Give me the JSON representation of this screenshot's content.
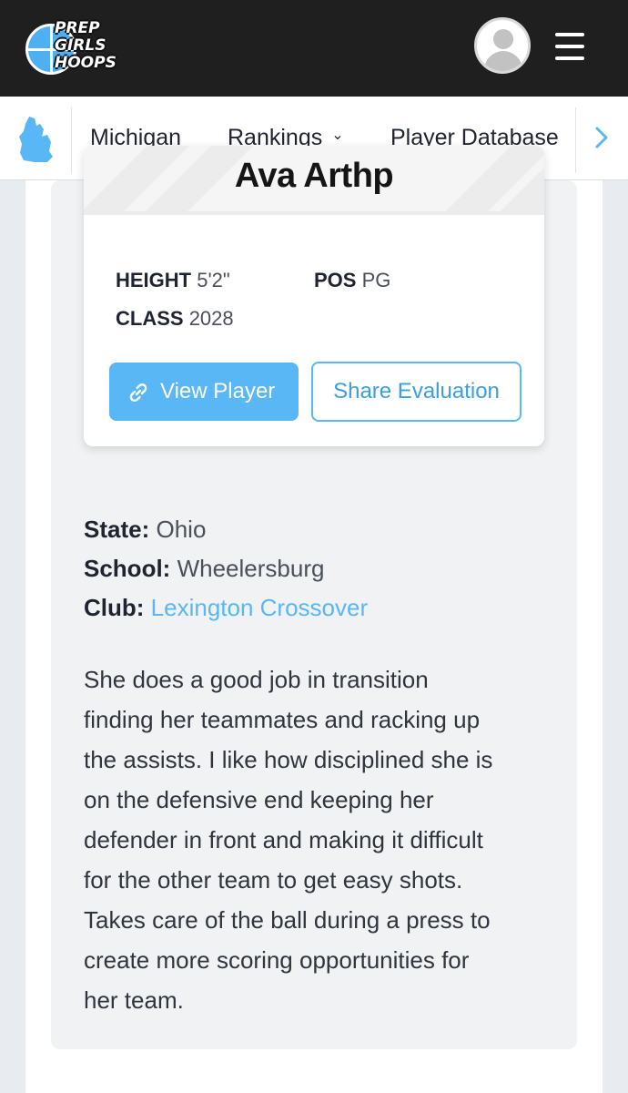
{
  "header": {
    "logo": {
      "line1": "PREP",
      "line2": "GIRLS",
      "line3": "HOOPS"
    },
    "avatar_icon": "user-avatar-icon",
    "menu_icon": "hamburger-menu-icon"
  },
  "nav": {
    "state_icon": "michigan-map-icon",
    "items": [
      {
        "label": "Michigan"
      },
      {
        "label": "Rankings",
        "chevron": "⌄"
      },
      {
        "label": "Player Database"
      }
    ],
    "next_icon": "chevron-right-icon"
  },
  "player_card": {
    "name": "Ava Arthp",
    "height_label": "HEIGHT",
    "height_value": "5'2\"",
    "pos_label": "POS",
    "pos_value": "PG",
    "class_label": "CLASS",
    "class_value": "2028",
    "view_button": "View Player",
    "share_button": "Share Evaluation"
  },
  "details": {
    "state_label": "State:",
    "state_value": "Ohio",
    "school_label": "School:",
    "school_value": "Wheelersburg",
    "club_label": "Club:",
    "club_value": "Lexington Crossover"
  },
  "evaluation": {
    "lines": [
      "She does a good job in transition",
      "finding her teammates and racking up",
      "the assists. I like how disciplined she is",
      "on the defensive end keeping her",
      "defender in front and making it difficult",
      "for the other team to get easy shots.",
      "Takes care of the ball during a press to",
      "create more scoring opportunities for",
      "her team."
    ]
  },
  "colors": {
    "accent": "#58b7f4",
    "topbar": "#1f1f1f",
    "panel": "#f1f2f4",
    "page_bg": "#e8ebef"
  }
}
